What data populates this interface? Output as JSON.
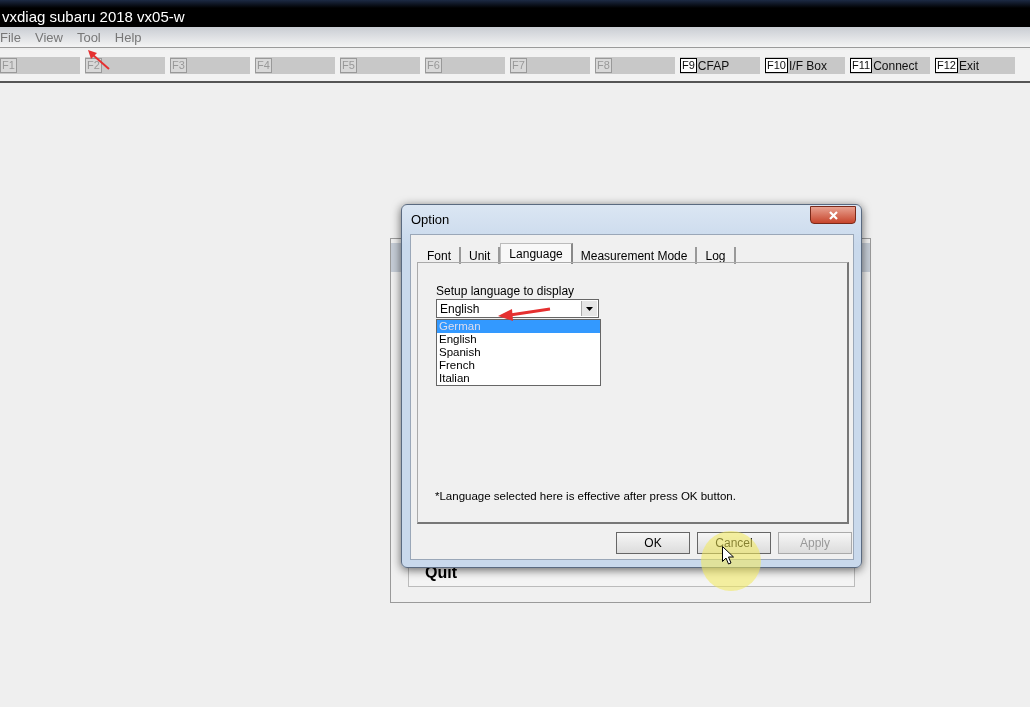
{
  "window": {
    "title": "vxdiag subaru 2018 vx05-w"
  },
  "menu": [
    {
      "label": "File"
    },
    {
      "label": "View"
    },
    {
      "label": "Tool"
    },
    {
      "label": "Help"
    }
  ],
  "function_keys": [
    {
      "key": "F1",
      "disabled": true
    },
    {
      "key": "F2",
      "disabled": true
    },
    {
      "key": "F3",
      "disabled": true
    },
    {
      "key": "F4",
      "disabled": true
    },
    {
      "key": "F5",
      "disabled": true
    },
    {
      "key": "F6",
      "disabled": true
    },
    {
      "key": "F7",
      "disabled": true
    },
    {
      "key": "F8",
      "disabled": true
    },
    {
      "key": "F9",
      "label": "CFAP",
      "disabled": false
    },
    {
      "key": "F10",
      "label": "I/F Box",
      "disabled": false
    },
    {
      "key": "F11",
      "label": "Connect",
      "disabled": false
    },
    {
      "key": "F12",
      "label": "Exit",
      "disabled": false
    }
  ],
  "background_panel": {
    "button": "Quit"
  },
  "dialog": {
    "title": "Option",
    "tabs": [
      {
        "label": "Font",
        "selected": false
      },
      {
        "label": "Unit",
        "selected": false
      },
      {
        "label": "Language",
        "selected": true
      },
      {
        "label": "Measurement Mode",
        "selected": false
      },
      {
        "label": "Log",
        "selected": false
      }
    ],
    "prompt": "Setup language to display",
    "dropdown": {
      "value": "English",
      "expanded": true,
      "options": [
        {
          "label": "German",
          "highlighted": true
        },
        {
          "label": "English",
          "highlighted": false
        },
        {
          "label": "Spanish",
          "highlighted": false
        },
        {
          "label": "French",
          "highlighted": false
        },
        {
          "label": "Italian",
          "highlighted": false
        }
      ]
    },
    "note": "*Language selected here is effective after press OK button.",
    "buttons": [
      {
        "label": "OK",
        "disabled": false
      },
      {
        "label": "Cancel",
        "disabled": false
      },
      {
        "label": "Apply",
        "disabled": true
      }
    ]
  }
}
